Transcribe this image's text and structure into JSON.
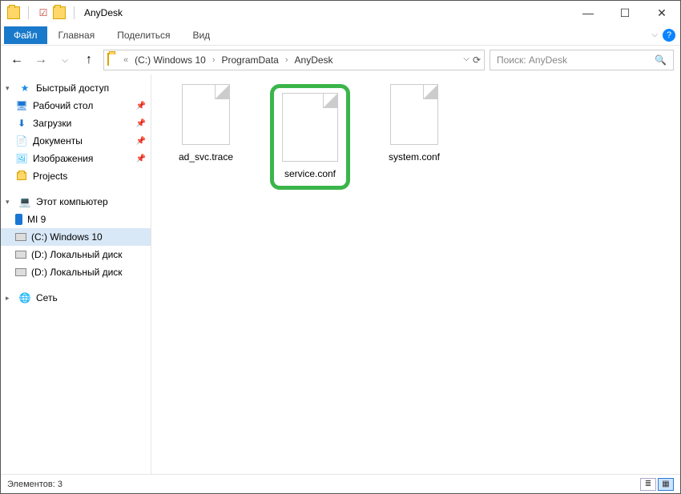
{
  "title": "AnyDesk",
  "menubar": {
    "file": "Файл",
    "tabs": [
      "Главная",
      "Поделиться",
      "Вид"
    ]
  },
  "nav": {
    "back": "←",
    "forward": "→",
    "up": "↑",
    "breadcrumbs_prefix": "«",
    "breadcrumbs": [
      "(C:) Windows 10",
      "ProgramData",
      "AnyDesk"
    ]
  },
  "search": {
    "placeholder": "Поиск: AnyDesk"
  },
  "sidebar": {
    "quick": {
      "label": "Быстрый доступ",
      "items": [
        {
          "label": "Рабочий стол",
          "icon": "desktop",
          "pin": true
        },
        {
          "label": "Загрузки",
          "icon": "download",
          "pin": true
        },
        {
          "label": "Документы",
          "icon": "docs",
          "pin": true
        },
        {
          "label": "Изображения",
          "icon": "img",
          "pin": true
        },
        {
          "label": "Projects",
          "icon": "folder",
          "pin": false
        }
      ]
    },
    "pc": {
      "label": "Этот компьютер",
      "items": [
        {
          "label": "MI 9",
          "icon": "phone"
        },
        {
          "label": "(C:) Windows 10",
          "icon": "drive",
          "selected": true
        },
        {
          "label": "(D:) Локальный диск",
          "icon": "drive"
        },
        {
          "label": "(D:) Локальный диск",
          "icon": "drive"
        }
      ]
    },
    "network": {
      "label": "Сеть"
    }
  },
  "files": [
    {
      "name": "ad_svc.trace",
      "highlight": false
    },
    {
      "name": "service.conf",
      "highlight": true
    },
    {
      "name": "system.conf",
      "highlight": false
    }
  ],
  "status": {
    "items_label": "Элементов: 3"
  }
}
